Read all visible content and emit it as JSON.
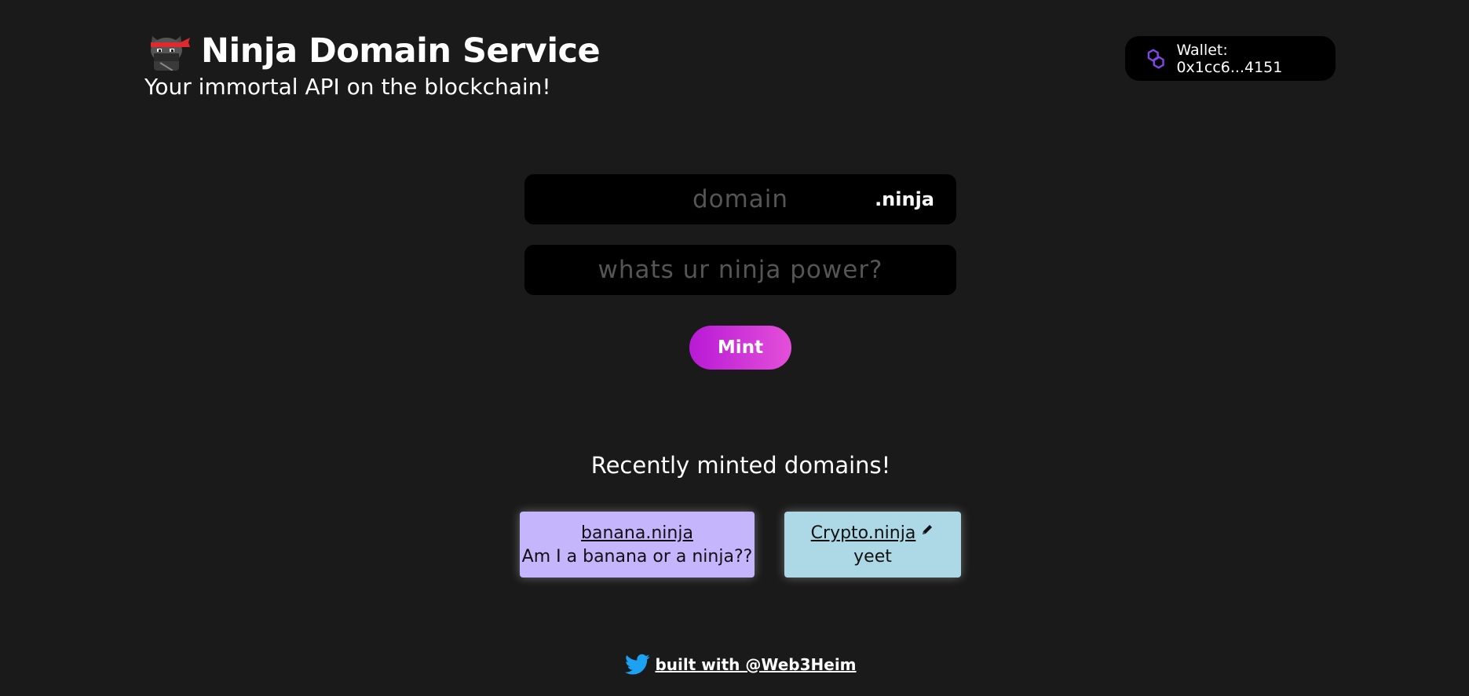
{
  "header": {
    "title": "Ninja Domain Service",
    "subtitle": "Your immortal API on the blockchain!",
    "logo_icon": "ninja-cat-icon"
  },
  "wallet": {
    "label": "Wallet: 0x1cc6...4151",
    "icon": "polygon-icon",
    "icon_color": "#8247e5"
  },
  "form": {
    "domain_placeholder": "domain",
    "tld": ".ninja",
    "power_placeholder": "whats ur ninja power?",
    "mint_label": "Mint",
    "mint_gradient": [
      "#b81ad6",
      "#e44fd9"
    ]
  },
  "recent": {
    "title": "Recently minted domains!",
    "items": [
      {
        "domain": "banana.ninja",
        "record": "Am I a banana or a ninja??",
        "color": "#c4b5fd"
      },
      {
        "domain": "Crypto.ninja",
        "record": "yeet",
        "color": "#add8e6",
        "editable": true
      }
    ]
  },
  "footer": {
    "link_text": "built with @Web3Heim",
    "icon": "twitter-icon"
  }
}
